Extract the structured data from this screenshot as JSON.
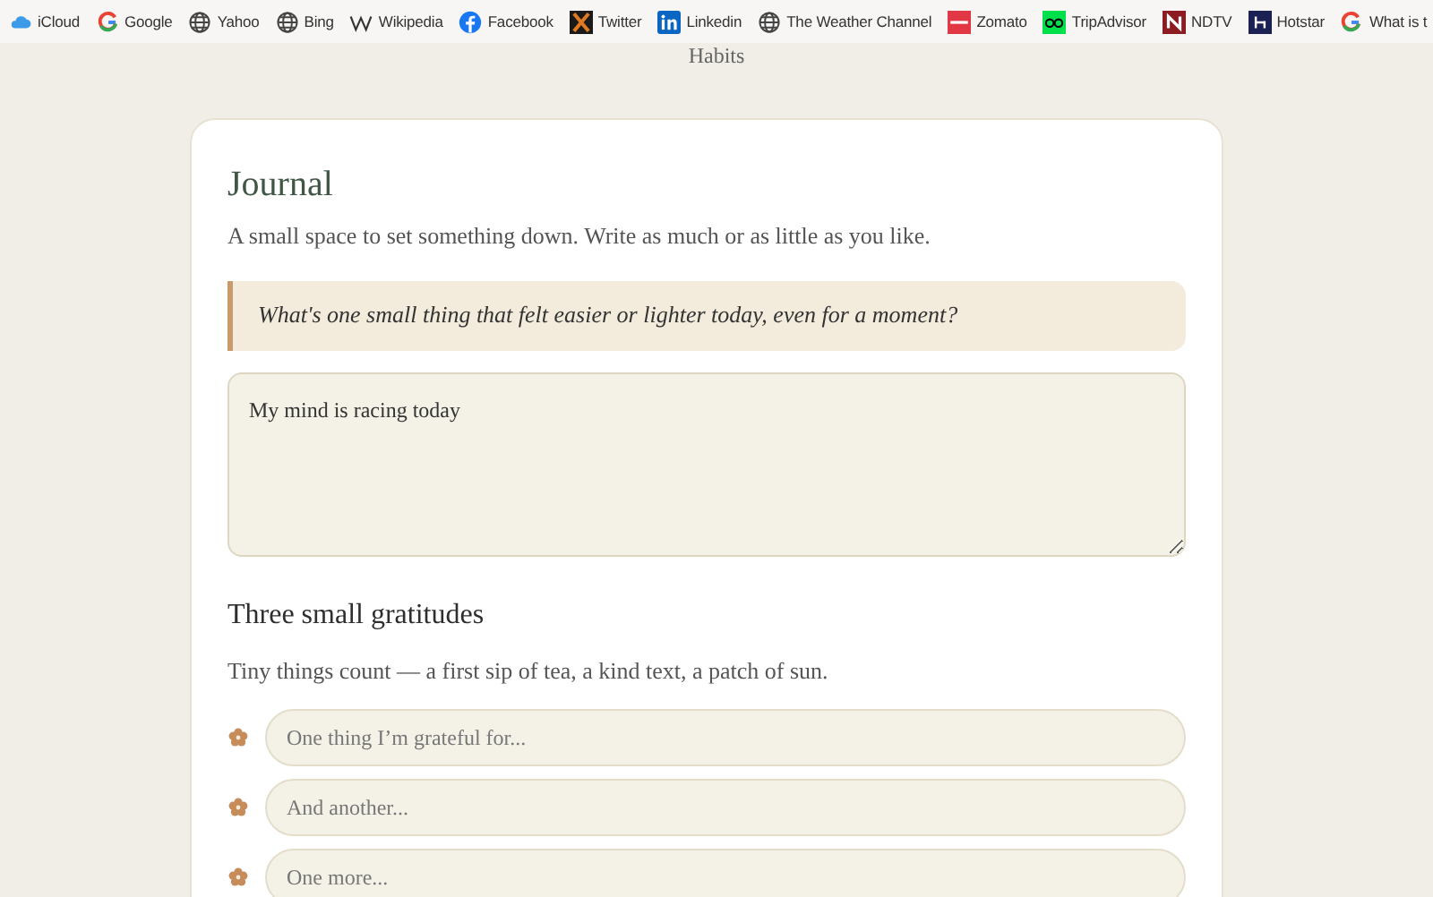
{
  "bookmarks": [
    {
      "label": "iCloud",
      "kind": "cloud"
    },
    {
      "label": "Google",
      "kind": "google"
    },
    {
      "label": "Yahoo",
      "kind": "globe"
    },
    {
      "label": "Bing",
      "kind": "globe"
    },
    {
      "label": "Wikipedia",
      "kind": "wiki"
    },
    {
      "label": "Facebook",
      "kind": "facebook"
    },
    {
      "label": "Twitter",
      "kind": "twitter"
    },
    {
      "label": "Linkedin",
      "kind": "linkedin"
    },
    {
      "label": "The Weather Channel",
      "kind": "globe"
    },
    {
      "label": "Zomato",
      "kind": "zomato"
    },
    {
      "label": "TripAdvisor",
      "kind": "tripadvisor"
    },
    {
      "label": "NDTV",
      "kind": "ndtv"
    },
    {
      "label": "Hotstar",
      "kind": "hotstar"
    },
    {
      "label": "What is t",
      "kind": "google"
    }
  ],
  "nav_label": "Habits",
  "journal": {
    "title": "Journal",
    "subtitle": "A small space to set something down. Write as much or as little as you like.",
    "prompt": "What's one small thing that felt easier or lighter today, even for a moment?",
    "entry": "My mind is racing today"
  },
  "gratitudes": {
    "title": "Three small gratitudes",
    "subtitle": "Tiny things count — a first sip of tea, a kind text, a patch of sun.",
    "fields": [
      {
        "placeholder": "One thing I’m grateful for..."
      },
      {
        "placeholder": "And another..."
      },
      {
        "placeholder": "One more..."
      }
    ]
  }
}
